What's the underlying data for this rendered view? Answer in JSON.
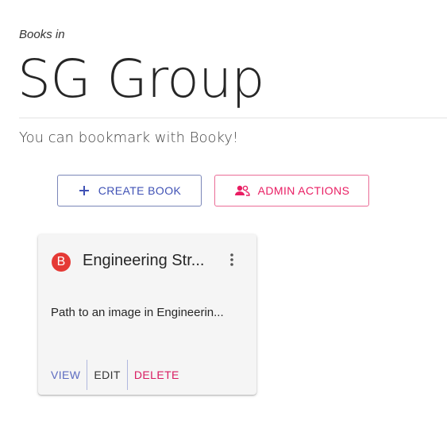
{
  "header": {
    "subtitle": "Books in",
    "group_name": "SG Group",
    "tagline": "You can bookmark with Booky!"
  },
  "toolbar": {
    "create_label": "CREATE BOOK",
    "admin_label": "ADMIN ACTIONS"
  },
  "book": {
    "avatar_letter": "B",
    "title": "Engineering Str...",
    "description": "Path to an image in Engineerin...",
    "actions": {
      "view": "VIEW",
      "edit": "EDIT",
      "delete": "DELETE"
    }
  },
  "colors": {
    "primary": "#3f51b5",
    "secondary": "#e91e63",
    "avatar": "#e53935"
  }
}
